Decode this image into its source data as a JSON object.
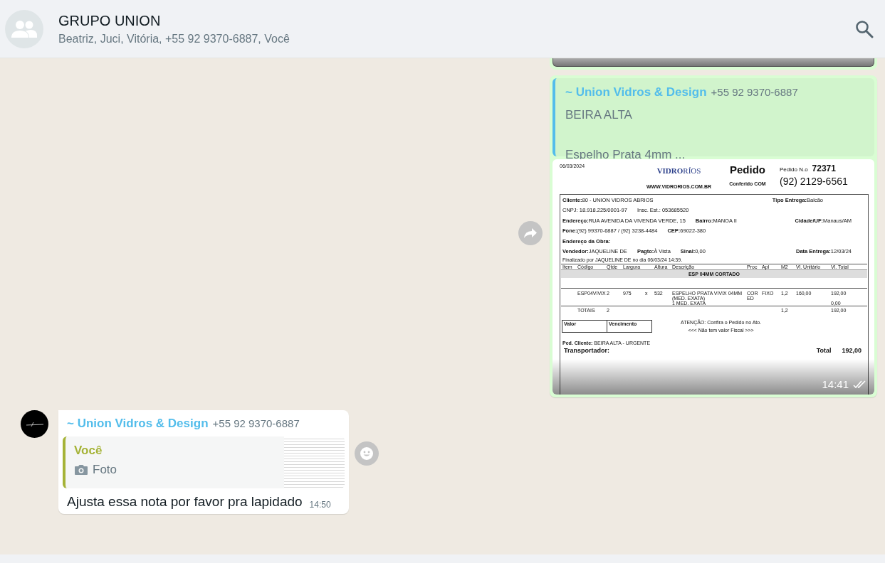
{
  "header": {
    "title": "GRUPO UNION",
    "members": "Beatriz, Juci, Vitória, +55 92 9370-6887, Você"
  },
  "messages": [
    {
      "kind": "image",
      "outgoing": true,
      "forwardable": true,
      "quote": {
        "sender": "~ Union Vidros & Design",
        "phone": "+55 92 9370-6887",
        "text": "BEIRA ALTA\n\nEspelho Prata 4mm ..."
      },
      "time": "14:41",
      "read": true,
      "document": {
        "date": "06/03/2024",
        "brand": "**VIDRO**RÍOS",
        "title": "Pedido",
        "number_label": "Pedido N.o",
        "number": "72371",
        "website": "WWW.VIDRORIOS.COM.BR",
        "checked_label": "Conferido COM",
        "phone": "(92) 2129-6561",
        "info_rows": [
          [
            {
              "label": "Cliente:",
              "value": "80 - UNION VIDROS ABRIOS"
            },
            {
              "label": "Tipo Entrega:",
              "value": "Balcão"
            }
          ],
          [
            {
              "value": "CNPJ: 18.918.225/0001-97"
            },
            {
              "value": "Insc. Est.: 053685520"
            }
          ],
          [
            {
              "label": "Endereço:",
              "value": "RUA AVENIDA DA VIVENDA VERDE, 15"
            },
            {
              "label": "Bairro:",
              "value": "MANOA II"
            },
            {
              "label": "Cidade/UF:",
              "value": "Manaus/AM"
            }
          ],
          [
            {
              "label": "Fone:",
              "value": "(92) 99370-6887 / (92) 3238-4484"
            },
            {
              "label": "CEP:",
              "value": "69022-380"
            }
          ],
          [
            {
              "label": "Endereço da Obra:"
            }
          ],
          [
            {
              "label": "Vendedor:",
              "value": "JAQUELINE DE"
            },
            {
              "label": "Pagto:",
              "value": "À Vista"
            },
            {
              "label": "Sinal:",
              "value": "0,00"
            },
            {
              "label": "Data Entrega:",
              "value": "12/03/24"
            }
          ]
        ],
        "finalized": "Finalizado por JAQUELINE DE no dia 06/03/24 14:39.",
        "columns": [
          "Item",
          "Código",
          "Qtde",
          "Largura",
          "",
          "Altura",
          "Descrição",
          "Proc",
          "Apl",
          "M2",
          "Vl. Unitário",
          "Vl. Total"
        ],
        "section": "ESP 04MM CORTADO",
        "rows": [
          {
            "kind": "item",
            "cells": [
              "",
              "ESP04VIVIX",
              "2",
              "975",
              "x",
              "532",
              "ESPELHO PRATA VIVIX 04MM (MED. EXATA)",
              "CORED",
              "FIXO",
              "1,2",
              "160,00",
              "192,00"
            ]
          },
          {
            "kind": "sub",
            "cells": [
              "",
              "",
              "",
              "",
              "",
              "",
              "1 MED. EXATA",
              "",
              "",
              "",
              "",
              "0,00"
            ]
          },
          {
            "kind": "total",
            "cells": [
              "",
              "TOTAIS",
              "2",
              "",
              "",
              "",
              "",
              "",
              "",
              "1,2",
              "",
              "192,00"
            ]
          }
        ],
        "payment_columns": [
          "Valor",
          "Vencimento"
        ],
        "notice": "ATENÇÃO: Confira o Pedido no Ato.",
        "fiscal_note": "<<< Não tem valor Fiscal >>>",
        "client_order_label": "Ped. Cliente:",
        "client_order": "BEIRA ALTA - URGENTE",
        "carrier_label": "Transportador:",
        "total_label": "Total",
        "total": "192,00"
      }
    },
    {
      "kind": "text",
      "outgoing": false,
      "sender": "~ Union Vidros & Design",
      "phone": "+55 92 9370-6887",
      "quote": {
        "sender": "Você",
        "media_label": "Foto"
      },
      "text": "Ajusta essa nota por favor pra lapidado",
      "time": "14:50"
    }
  ]
}
